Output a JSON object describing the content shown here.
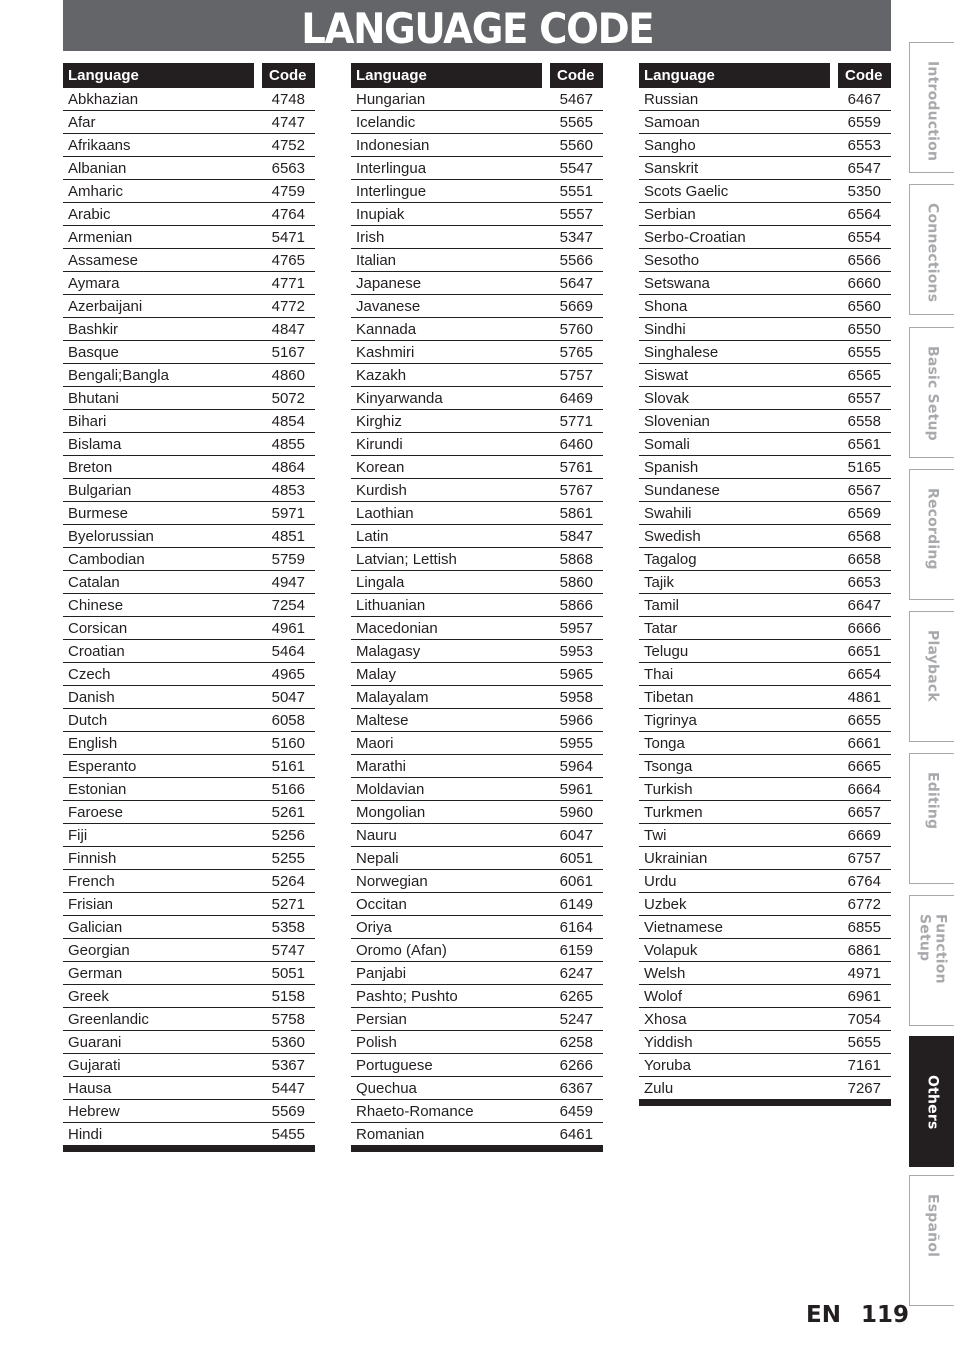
{
  "title": "LANGUAGE CODE",
  "headers": {
    "language": "Language",
    "code": "Code"
  },
  "columns": [
    [
      [
        "Abkhazian",
        "4748"
      ],
      [
        "Afar",
        "4747"
      ],
      [
        "Afrikaans",
        "4752"
      ],
      [
        "Albanian",
        "6563"
      ],
      [
        "Amharic",
        "4759"
      ],
      [
        "Arabic",
        "4764"
      ],
      [
        "Armenian",
        "5471"
      ],
      [
        "Assamese",
        "4765"
      ],
      [
        "Aymara",
        "4771"
      ],
      [
        "Azerbaijani",
        "4772"
      ],
      [
        "Bashkir",
        "4847"
      ],
      [
        "Basque",
        "5167"
      ],
      [
        "Bengali;Bangla",
        "4860"
      ],
      [
        "Bhutani",
        "5072"
      ],
      [
        "Bihari",
        "4854"
      ],
      [
        "Bislama",
        "4855"
      ],
      [
        "Breton",
        "4864"
      ],
      [
        "Bulgarian",
        "4853"
      ],
      [
        "Burmese",
        "5971"
      ],
      [
        "Byelorussian",
        "4851"
      ],
      [
        "Cambodian",
        "5759"
      ],
      [
        "Catalan",
        "4947"
      ],
      [
        "Chinese",
        "7254"
      ],
      [
        "Corsican",
        "4961"
      ],
      [
        "Croatian",
        "5464"
      ],
      [
        "Czech",
        "4965"
      ],
      [
        "Danish",
        "5047"
      ],
      [
        "Dutch",
        "6058"
      ],
      [
        "English",
        "5160"
      ],
      [
        "Esperanto",
        "5161"
      ],
      [
        "Estonian",
        "5166"
      ],
      [
        "Faroese",
        "5261"
      ],
      [
        "Fiji",
        "5256"
      ],
      [
        "Finnish",
        "5255"
      ],
      [
        "French",
        "5264"
      ],
      [
        "Frisian",
        "5271"
      ],
      [
        "Galician",
        "5358"
      ],
      [
        "Georgian",
        "5747"
      ],
      [
        "German",
        "5051"
      ],
      [
        "Greek",
        "5158"
      ],
      [
        "Greenlandic",
        "5758"
      ],
      [
        "Guarani",
        "5360"
      ],
      [
        "Gujarati",
        "5367"
      ],
      [
        "Hausa",
        "5447"
      ],
      [
        "Hebrew",
        "5569"
      ],
      [
        "Hindi",
        "5455"
      ]
    ],
    [
      [
        "Hungarian",
        "5467"
      ],
      [
        "Icelandic",
        "5565"
      ],
      [
        "Indonesian",
        "5560"
      ],
      [
        "Interlingua",
        "5547"
      ],
      [
        "Interlingue",
        "5551"
      ],
      [
        "Inupiak",
        "5557"
      ],
      [
        "Irish",
        "5347"
      ],
      [
        "Italian",
        "5566"
      ],
      [
        "Japanese",
        "5647"
      ],
      [
        "Javanese",
        "5669"
      ],
      [
        "Kannada",
        "5760"
      ],
      [
        "Kashmiri",
        "5765"
      ],
      [
        "Kazakh",
        "5757"
      ],
      [
        "Kinyarwanda",
        "6469"
      ],
      [
        "Kirghiz",
        "5771"
      ],
      [
        "Kirundi",
        "6460"
      ],
      [
        "Korean",
        "5761"
      ],
      [
        "Kurdish",
        "5767"
      ],
      [
        "Laothian",
        "5861"
      ],
      [
        "Latin",
        "5847"
      ],
      [
        "Latvian; Lettish",
        "5868"
      ],
      [
        "Lingala",
        "5860"
      ],
      [
        "Lithuanian",
        "5866"
      ],
      [
        "Macedonian",
        "5957"
      ],
      [
        "Malagasy",
        "5953"
      ],
      [
        "Malay",
        "5965"
      ],
      [
        "Malayalam",
        "5958"
      ],
      [
        "Maltese",
        "5966"
      ],
      [
        "Maori",
        "5955"
      ],
      [
        "Marathi",
        "5964"
      ],
      [
        "Moldavian",
        "5961"
      ],
      [
        "Mongolian",
        "5960"
      ],
      [
        "Nauru",
        "6047"
      ],
      [
        "Nepali",
        "6051"
      ],
      [
        "Norwegian",
        "6061"
      ],
      [
        "Occitan",
        "6149"
      ],
      [
        "Oriya",
        "6164"
      ],
      [
        "Oromo (Afan)",
        "6159"
      ],
      [
        "Panjabi",
        "6247"
      ],
      [
        "Pashto; Pushto",
        "6265"
      ],
      [
        "Persian",
        "5247"
      ],
      [
        "Polish",
        "6258"
      ],
      [
        "Portuguese",
        "6266"
      ],
      [
        "Quechua",
        "6367"
      ],
      [
        "Rhaeto-Romance",
        "6459"
      ],
      [
        "Romanian",
        "6461"
      ]
    ],
    [
      [
        "Russian",
        "6467"
      ],
      [
        "Samoan",
        "6559"
      ],
      [
        "Sangho",
        "6553"
      ],
      [
        "Sanskrit",
        "6547"
      ],
      [
        "Scots Gaelic",
        "5350"
      ],
      [
        "Serbian",
        "6564"
      ],
      [
        "Serbo-Croatian",
        "6554"
      ],
      [
        "Sesotho",
        "6566"
      ],
      [
        "Setswana",
        "6660"
      ],
      [
        "Shona",
        "6560"
      ],
      [
        "Sindhi",
        "6550"
      ],
      [
        "Singhalese",
        "6555"
      ],
      [
        "Siswat",
        "6565"
      ],
      [
        "Slovak",
        "6557"
      ],
      [
        "Slovenian",
        "6558"
      ],
      [
        "Somali",
        "6561"
      ],
      [
        "Spanish",
        "5165"
      ],
      [
        "Sundanese",
        "6567"
      ],
      [
        "Swahili",
        "6569"
      ],
      [
        "Swedish",
        "6568"
      ],
      [
        "Tagalog",
        "6658"
      ],
      [
        "Tajik",
        "6653"
      ],
      [
        "Tamil",
        "6647"
      ],
      [
        "Tatar",
        "6666"
      ],
      [
        "Telugu",
        "6651"
      ],
      [
        "Thai",
        "6654"
      ],
      [
        "Tibetan",
        "4861"
      ],
      [
        "Tigrinya",
        "6655"
      ],
      [
        "Tonga",
        "6661"
      ],
      [
        "Tsonga",
        "6665"
      ],
      [
        "Turkish",
        "6664"
      ],
      [
        "Turkmen",
        "6657"
      ],
      [
        "Twi",
        "6669"
      ],
      [
        "Ukrainian",
        "6757"
      ],
      [
        "Urdu",
        "6764"
      ],
      [
        "Uzbek",
        "6772"
      ],
      [
        "Vietnamese",
        "6855"
      ],
      [
        "Volapuk",
        "6861"
      ],
      [
        "Welsh",
        "4971"
      ],
      [
        "Wolof",
        "6961"
      ],
      [
        "Xhosa",
        "7054"
      ],
      [
        "Yiddish",
        "5655"
      ],
      [
        "Yoruba",
        "7161"
      ],
      [
        "Zulu",
        "7267"
      ]
    ]
  ],
  "side_tabs": [
    {
      "label": "Introduction",
      "active": false
    },
    {
      "label": "Connections",
      "active": false
    },
    {
      "label": "Basic Setup",
      "active": false
    },
    {
      "label": "Recording",
      "active": false
    },
    {
      "label": "Playback",
      "active": false
    },
    {
      "label": "Editing",
      "active": false
    },
    {
      "label": "Function Setup",
      "active": false
    },
    {
      "label": "Others",
      "active": true
    },
    {
      "label": "Español",
      "active": false
    }
  ],
  "footer": {
    "lang": "EN",
    "page": "119"
  }
}
